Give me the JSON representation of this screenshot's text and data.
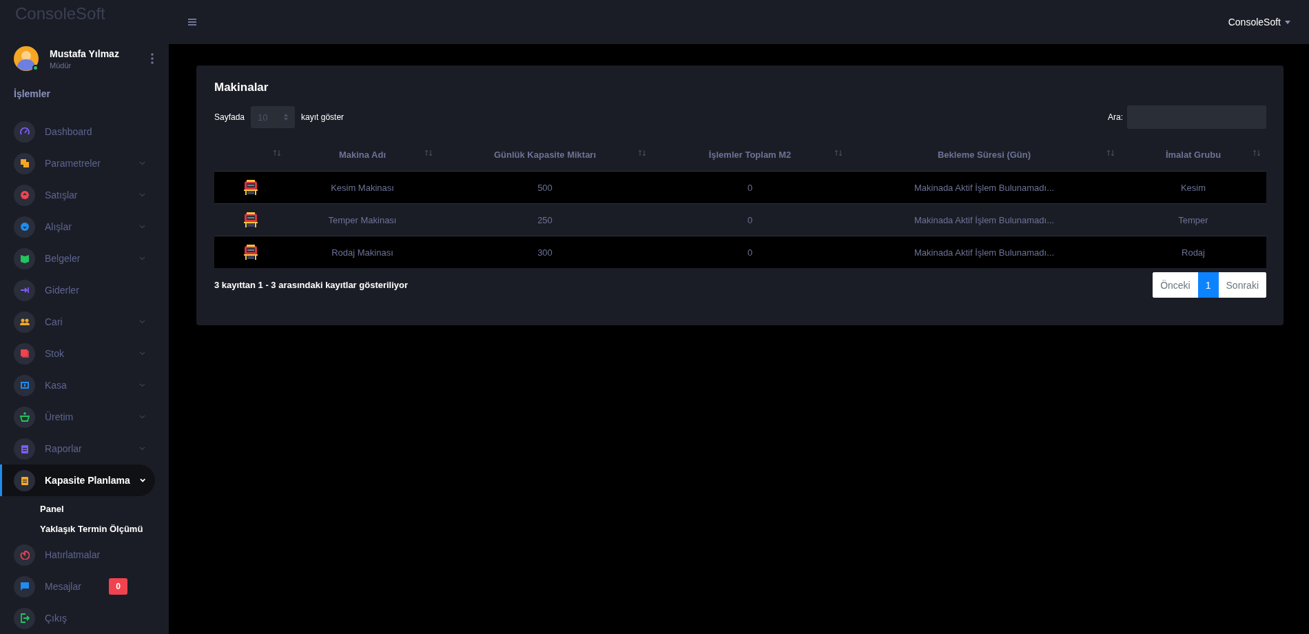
{
  "brand": {
    "logo": "ConsoleSoft"
  },
  "topbar": {
    "user_menu": "ConsoleSoft"
  },
  "user": {
    "name": "Mustafa Yılmaz",
    "role": "Müdür",
    "online": true
  },
  "sidebar": {
    "heading": "İşlemler",
    "items": [
      {
        "label": "Dashboard",
        "color": "#7c5cf5",
        "expandable": false,
        "selected": false
      },
      {
        "label": "Parametreler",
        "color": "#f5a623",
        "expandable": true,
        "selected": false
      },
      {
        "label": "Satışlar",
        "color": "#f0434f",
        "expandable": true,
        "selected": false
      },
      {
        "label": "Alışlar",
        "color": "#1e8cf0",
        "expandable": true,
        "selected": false
      },
      {
        "label": "Belgeler",
        "color": "#22c55e",
        "expandable": true,
        "selected": false
      },
      {
        "label": "Giderler",
        "color": "#7c5cf5",
        "expandable": false,
        "selected": false
      },
      {
        "label": "Cari",
        "color": "#f5a623",
        "expandable": true,
        "selected": false
      },
      {
        "label": "Stok",
        "color": "#f0434f",
        "expandable": true,
        "selected": false
      },
      {
        "label": "Kasa",
        "color": "#1e8cf0",
        "expandable": true,
        "selected": false
      },
      {
        "label": "Üretim",
        "color": "#22c55e",
        "expandable": true,
        "selected": false
      },
      {
        "label": "Raporlar",
        "color": "#7c5cf5",
        "expandable": true,
        "selected": false
      },
      {
        "label": "Kapasite Planlama",
        "color": "#f5a623",
        "expandable": true,
        "selected": true,
        "expanded": true,
        "children": [
          {
            "label": "Panel"
          },
          {
            "label": "Yaklaşık Termin Ölçümü"
          }
        ]
      },
      {
        "label": "Hatırlatmalar",
        "color": "#f0434f",
        "expandable": false,
        "selected": false
      },
      {
        "label": "Mesajlar",
        "color": "#1e8cf0",
        "expandable": false,
        "selected": false,
        "badge": "0"
      },
      {
        "label": "Çıkış",
        "color": "#22c55e",
        "expandable": false,
        "selected": false
      }
    ]
  },
  "card": {
    "title": "Makinalar",
    "length": {
      "before": "Sayfada",
      "value": "10",
      "after": "kayıt göster"
    },
    "search": {
      "label": "Ara:"
    },
    "table": {
      "columns": [
        "Makina Adı",
        "Günlük Kapasite Miktarı",
        "İşlemler Toplam M2",
        "Bekleme Süresi (Gün)",
        "İmalat Grubu"
      ],
      "rows": [
        {
          "cells": [
            "Kesim Makinası",
            "500",
            "0",
            "Makinada Aktif İşlem Bulunamadı...",
            "Kesim"
          ]
        },
        {
          "cells": [
            "Temper Makinası",
            "250",
            "0",
            "Makinada Aktif İşlem Bulunamadı...",
            "Temper"
          ]
        },
        {
          "cells": [
            "Rodaj Makinası",
            "300",
            "0",
            "Makinada Aktif İşlem Bulunamadı...",
            "Rodaj"
          ]
        }
      ]
    },
    "info": "3 kayıttan 1 - 3 arasındaki kayıtlar gösteriliyor",
    "pagination": [
      {
        "label": "Önceki",
        "selected": false
      },
      {
        "label": "1",
        "selected": true
      },
      {
        "label": "Sonraki",
        "selected": false
      }
    ]
  }
}
